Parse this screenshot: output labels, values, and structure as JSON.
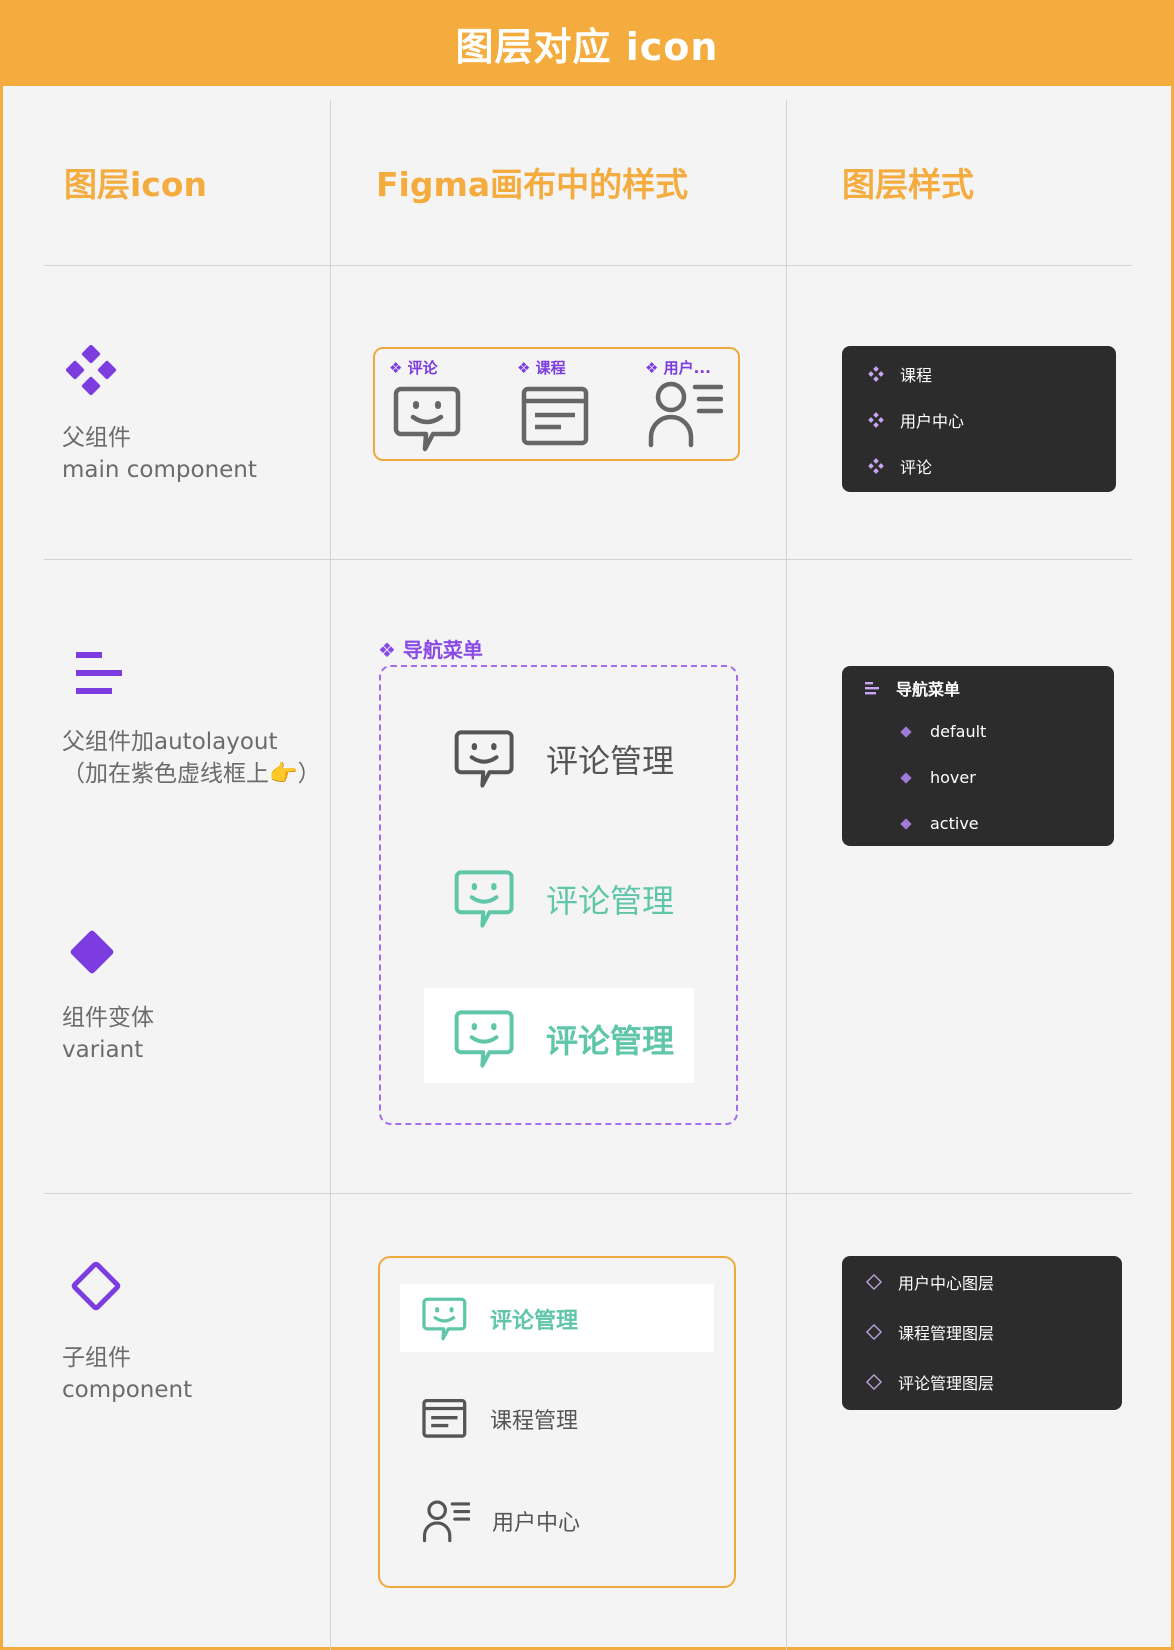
{
  "banner": {
    "title": "图层对应 icon"
  },
  "headers": {
    "col1": "图层icon",
    "col2": "Figma画布中的样式",
    "col3": "图层样式"
  },
  "rows": {
    "main": {
      "label_cn": "父组件",
      "label_en": "main component"
    },
    "autolayout": {
      "label_cn": "父组件加autolayout",
      "label_note": "（加在紫色虚线框上👉）"
    },
    "variant": {
      "label_cn": "组件变体",
      "label_en": "variant"
    },
    "child": {
      "label_cn": "子组件",
      "label_en": "component"
    }
  },
  "canvas": {
    "main_tags": [
      "❖ 评论",
      "❖ 课程",
      "❖ 用户..."
    ],
    "nav_tag": "❖ 导航菜单",
    "nav_items": [
      "评论管理",
      "评论管理",
      "评论管理"
    ],
    "sub_items": [
      "评论管理",
      "课程管理",
      "用户中心"
    ]
  },
  "panels": {
    "main": [
      "课程",
      "用户中心",
      "评论"
    ],
    "nav": {
      "parent": "导航菜单",
      "children": [
        "default",
        "hover",
        "active"
      ]
    },
    "child": [
      "用户中心图层",
      "课程管理图层",
      "评论管理图层"
    ]
  },
  "colors": {
    "accent_orange": "#f4ac3f",
    "purple": "#7c3ce0",
    "panel_dark": "#2c2c2c",
    "teal": "#5fc6a7",
    "gray_icon": "#666666"
  }
}
